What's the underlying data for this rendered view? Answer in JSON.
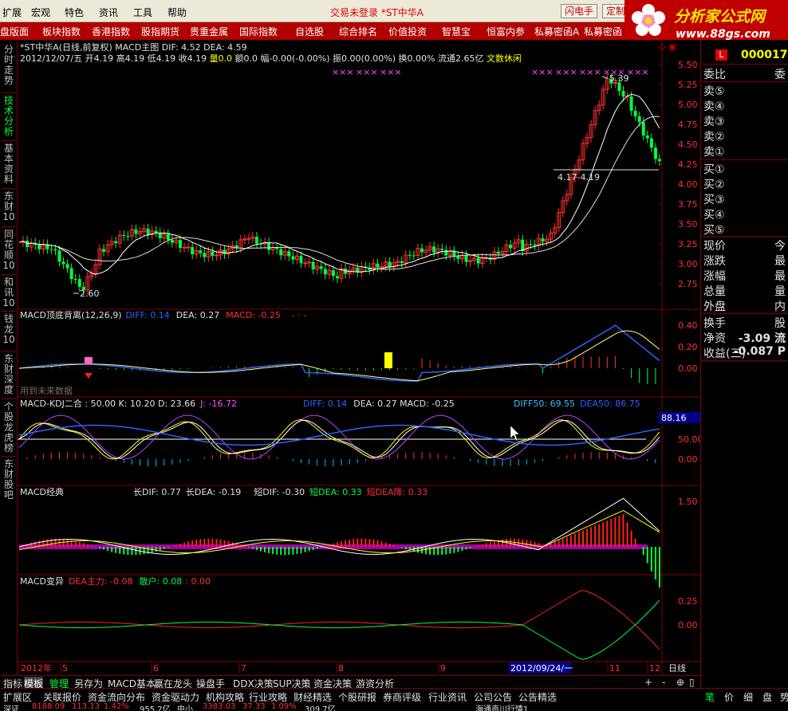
{
  "menu": {
    "items": [
      "扩展",
      "宏观",
      "特色",
      "资讯",
      "工具",
      "帮助"
    ],
    "status": "交易未登录 *ST中华A",
    "btn_flash": "闪电手",
    "btn_custom": "定制"
  },
  "logo": {
    "title": "分析家公式网",
    "url": "www.88gs.com"
  },
  "tabs": [
    "盘版面",
    "板块指数",
    "香港指数",
    "股指期货",
    "贵重金属",
    "国际指数",
    "自选股",
    "综合排名",
    "价值投资",
    "智慧宝",
    "恒富内参",
    "私募密函A",
    "私募密函B"
  ],
  "sidebar": [
    "分时走势",
    "技术分析",
    "基本资料",
    "东财10",
    "同花顺10",
    "和讯10",
    "钱龙10",
    "东财深度",
    "个股龙虎榜",
    "东财股吧"
  ],
  "main_panel": {
    "header": "*ST中华A(日线,前复权) MACD主图 DIF: 4.52 DEA: 4.59",
    "info_line_a": "2012/12/07/五 开4.19 高4.19 低4.19 收4.19 ",
    "info_vol": "量0.0",
    "info_line_b": " 额0.0 幅-0.00(-0.00%) 振0.00(0.00%) 换0.00% 流通2.65亿 ",
    "info_tag": "文数休闲",
    "y_ticks": [
      "5.50",
      "5.25",
      "5.00",
      "4.75",
      "4.50",
      "4.25",
      "4.00",
      "3.75",
      "3.50",
      "3.25",
      "3.00",
      "2.75"
    ],
    "ann_high": "5.39",
    "ann_low": "2.60",
    "ann_range": "4.17-4.19"
  },
  "panel2": {
    "title": "MACD顶底背离(12,26,9)",
    "diff": "DIFF: 0.14",
    "dea": "DEA: 0.27",
    "macd": "MACD: -0.25",
    "extra": "- · -",
    "note": "用到未来数据",
    "y_ticks": [
      "0.40",
      "0.20",
      "0.00"
    ]
  },
  "panel3": {
    "title": "MACD-KDJ二合 : 50.00 K: 10.20 D: 23.66",
    "j": "J: -16.72",
    "diff": "DIFF: 0.14",
    "dea_macd": "DEA: 0.27 MACD: -0.25",
    "diff50": "DIFF50: 69.55",
    "dea50": "DEA50: 86.75",
    "y_ticks": [
      "50.00",
      "0.00"
    ],
    "cur_value": "88.16"
  },
  "panel4": {
    "title": "MACD经典",
    "long_dif": "长DIF: 0.77",
    "long_dea": "长DEA: -0.19",
    "short_dif": "短DIF: -0.30",
    "short_dea": "短DEA: 0.33",
    "short_dea2": "短DEA降: 0.33",
    "y_ticks": [
      "1.50"
    ]
  },
  "panel5": {
    "title": "MACD变异",
    "main": "DEA主力: -0.08",
    "retail": "散户: 0.08",
    "zero": ": 0.00",
    "y_ticks": [
      "0.25",
      "0.00"
    ]
  },
  "x_axis": {
    "labels": [
      "2012年",
      "5",
      "6",
      "7",
      "8",
      "9",
      "11",
      "12"
    ],
    "cursor_label": "2012/09/24/一",
    "period": "日线"
  },
  "right_panel": {
    "code": "000017",
    "rows": [
      {
        "label": "委比",
        "value": "委"
      },
      {
        "label": "卖⑤",
        "value": ""
      },
      {
        "label": "卖④",
        "value": ""
      },
      {
        "label": "卖③",
        "value": ""
      },
      {
        "label": "卖②",
        "value": ""
      },
      {
        "label": "卖①",
        "value": ""
      },
      {
        "label": "买①",
        "value": ""
      },
      {
        "label": "买②",
        "value": ""
      },
      {
        "label": "买③",
        "value": ""
      },
      {
        "label": "买④",
        "value": ""
      },
      {
        "label": "买⑤",
        "value": ""
      },
      {
        "label": "现价",
        "value": "今"
      },
      {
        "label": "涨跌",
        "value": "最"
      },
      {
        "label": "涨幅",
        "value": "最"
      },
      {
        "label": "总量",
        "value": "量"
      },
      {
        "label": "外盘",
        "value": "内"
      },
      {
        "label": "换手",
        "value": "股"
      },
      {
        "label": "净资",
        "value": "-3.09 流"
      },
      {
        "label": "收益(三)",
        "value": "-0.087 P"
      }
    ],
    "tabs": [
      "笔",
      "价",
      "细",
      "盘",
      "势"
    ]
  },
  "bottom_tabs": [
    "指标",
    "模板",
    "管理",
    "另存为",
    "MACD基本",
    "赢在龙头",
    "操盘手",
    "DDX决策",
    "SUP决策",
    "资金决策",
    "游资分析"
  ],
  "bottom_tabs2": [
    "扩展区",
    "关联报价",
    "资金流向分布",
    "资金驱动力",
    "机构攻略",
    "行业攻略",
    "财经精选",
    "个股研报",
    "券商评级",
    "行业资讯",
    "公司公告",
    "公告精选"
  ],
  "ticker": [
    "深证",
    "8188.09",
    "113.13",
    "1.42%",
    "955.2亿",
    "中小",
    "3383.03",
    "37.33",
    "1.09%",
    "309.7亿",
    "海通声川行情1"
  ]
}
